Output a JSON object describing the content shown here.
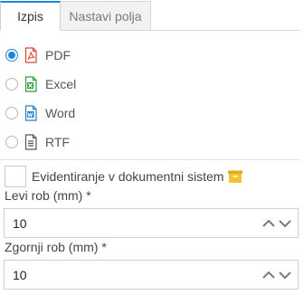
{
  "tabs": {
    "active_label": "Izpis",
    "inactive_label": "Nastavi polja"
  },
  "formats": {
    "selected": "PDF",
    "items": [
      {
        "label": "PDF",
        "icon": "pdf-file-icon",
        "color": "#d9443a"
      },
      {
        "label": "Excel",
        "icon": "excel-file-icon",
        "color": "#2e9b3e"
      },
      {
        "label": "Word",
        "icon": "word-file-icon",
        "color": "#2a7fc9"
      },
      {
        "label": "RTF",
        "icon": "text-file-icon",
        "color": "#555555"
      }
    ]
  },
  "archive": {
    "label": "Evidentiranje v dokumentni sistem",
    "checked": false,
    "icon": "archive-box-icon",
    "icon_color": "#f1c232"
  },
  "left_margin": {
    "label": "Levi rob (mm) *",
    "value": "10"
  },
  "top_margin": {
    "label": "Zgornji rob (mm) *",
    "value": "10"
  },
  "accent_color": "#1e88d3"
}
